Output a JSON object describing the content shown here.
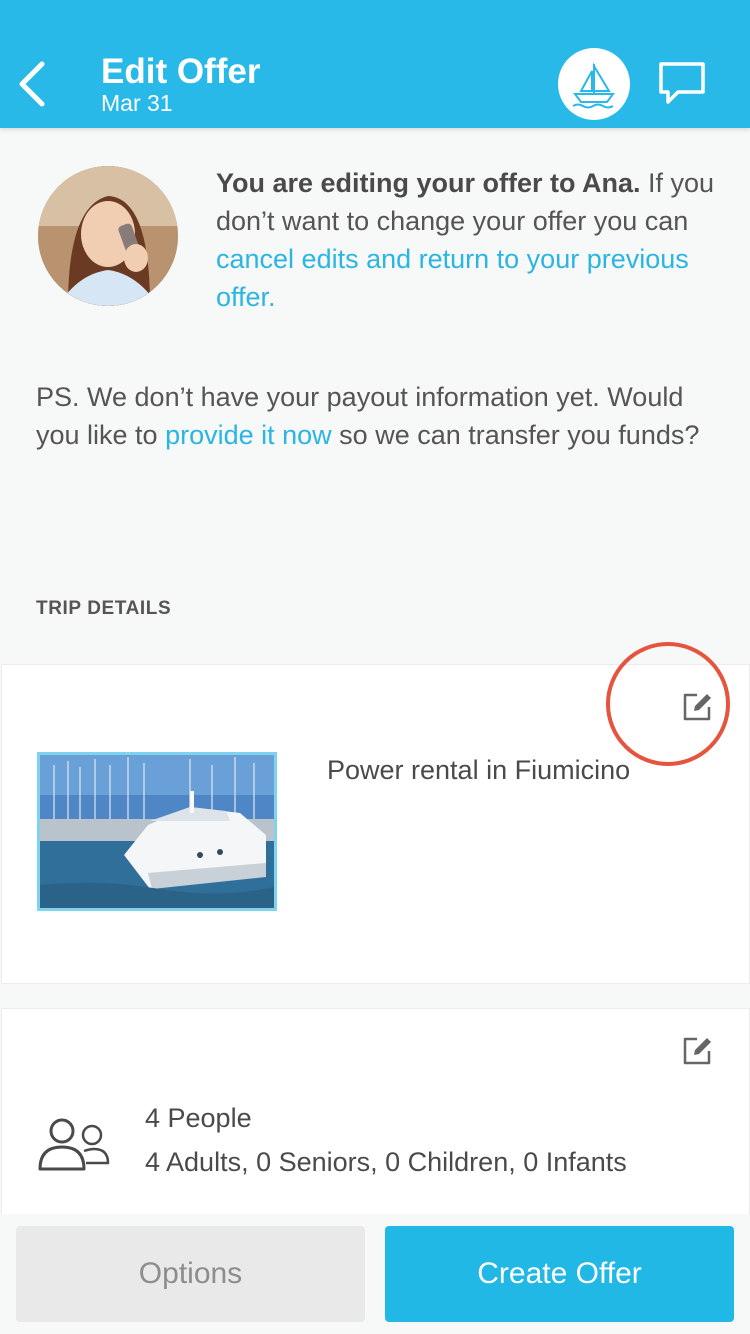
{
  "header": {
    "title": "Edit Offer",
    "subtitle": "Mar 31",
    "back_icon": "chevron-left-icon",
    "boat_icon": "sailboat-icon",
    "chat_icon": "chat-bubble-icon",
    "background_color": "#29b9e8"
  },
  "intro": {
    "bold": "You are editing your offer to Ana.",
    "text": " If you don’t want to change your offer you can ",
    "link": "cancel edits and return to your previous offer."
  },
  "ps": {
    "before": "PS. We don’t have your payout information yet. Would you like to ",
    "link": "provide it now",
    "after": " so we can transfer you funds?"
  },
  "trip_details": {
    "section_title": "TRIP DETAILS",
    "listing_title": "Power rental in Fiumicino",
    "people_count": "4 People",
    "people_detail": "4 Adults, 0 Seniors, 0 Children, 0 Infants"
  },
  "footer": {
    "options_label": "Options",
    "create_label": "Create Offer"
  },
  "colors": {
    "accent": "#29b9e8",
    "link": "#2bb5e3",
    "highlight_circle": "#e7543e"
  }
}
